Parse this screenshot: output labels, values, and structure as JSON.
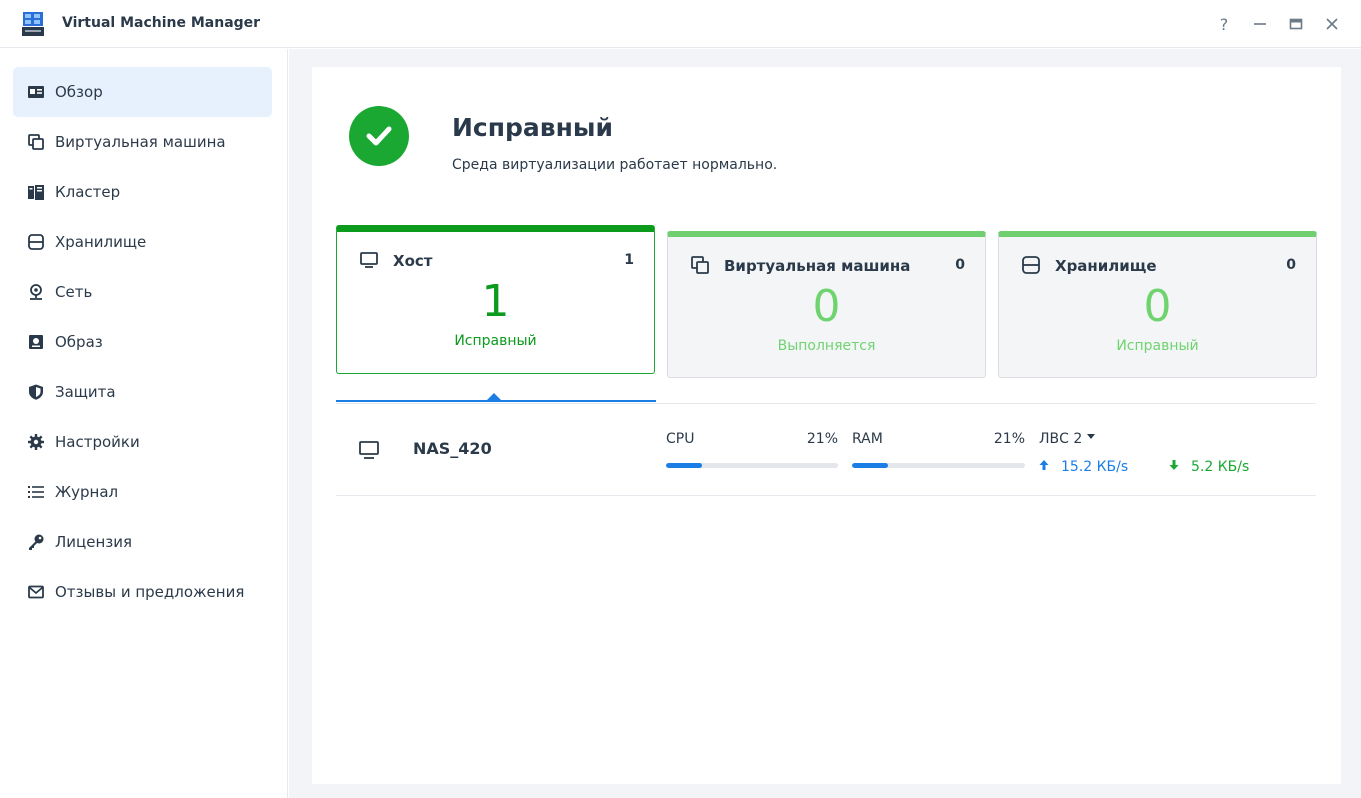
{
  "window": {
    "title": "Virtual Machine Manager",
    "help_label": "?",
    "minimize_label": "—",
    "maximize_label": "□",
    "close_label": "✕"
  },
  "sidebar": {
    "items": [
      {
        "label": "Обзор",
        "icon": "overview-icon",
        "active": true
      },
      {
        "label": "Виртуальная машина",
        "icon": "virtual-machine-icon",
        "active": false
      },
      {
        "label": "Кластер",
        "icon": "cluster-icon",
        "active": false
      },
      {
        "label": "Хранилище",
        "icon": "storage-icon",
        "active": false
      },
      {
        "label": "Сеть",
        "icon": "network-icon",
        "active": false
      },
      {
        "label": "Образ",
        "icon": "image-icon",
        "active": false
      },
      {
        "label": "Защита",
        "icon": "shield-icon",
        "active": false
      },
      {
        "label": "Настройки",
        "icon": "gear-icon",
        "active": false
      },
      {
        "label": "Журнал",
        "icon": "log-list-icon",
        "active": false
      },
      {
        "label": "Лицензия",
        "icon": "key-icon",
        "active": false
      },
      {
        "label": "Отзывы и предложения",
        "icon": "mail-icon",
        "active": false
      }
    ]
  },
  "status": {
    "title": "Исправный",
    "description": "Среда виртуализации работает нормально.",
    "icon": "check-circle-icon",
    "color": "#1aa832"
  },
  "cards": [
    {
      "title": "Хост",
      "count": "1",
      "big": "1",
      "status": "Исправный",
      "icon": "monitor-icon",
      "selected": true
    },
    {
      "title": "Виртуальная машина",
      "count": "0",
      "big": "0",
      "status": "Выполняется",
      "icon": "virtual-machine-icon",
      "selected": false
    },
    {
      "title": "Хранилище",
      "count": "0",
      "big": "0",
      "status": "Исправный",
      "icon": "storage-icon",
      "selected": false
    }
  ],
  "host": {
    "name": "NAS_420",
    "cpu_label": "CPU",
    "cpu_value": "21%",
    "cpu_fraction": 0.21,
    "ram_label": "RAM",
    "ram_value": "21%",
    "ram_fraction": 0.21,
    "lan_label": "ЛВС 2",
    "upload": "15.2 КБ/s",
    "download": "5.2 КБ/s"
  },
  "colors": {
    "accent_blue": "#1a7ee6",
    "healthy_green": "#0c9b1d",
    "light_green": "#6fd46f"
  }
}
